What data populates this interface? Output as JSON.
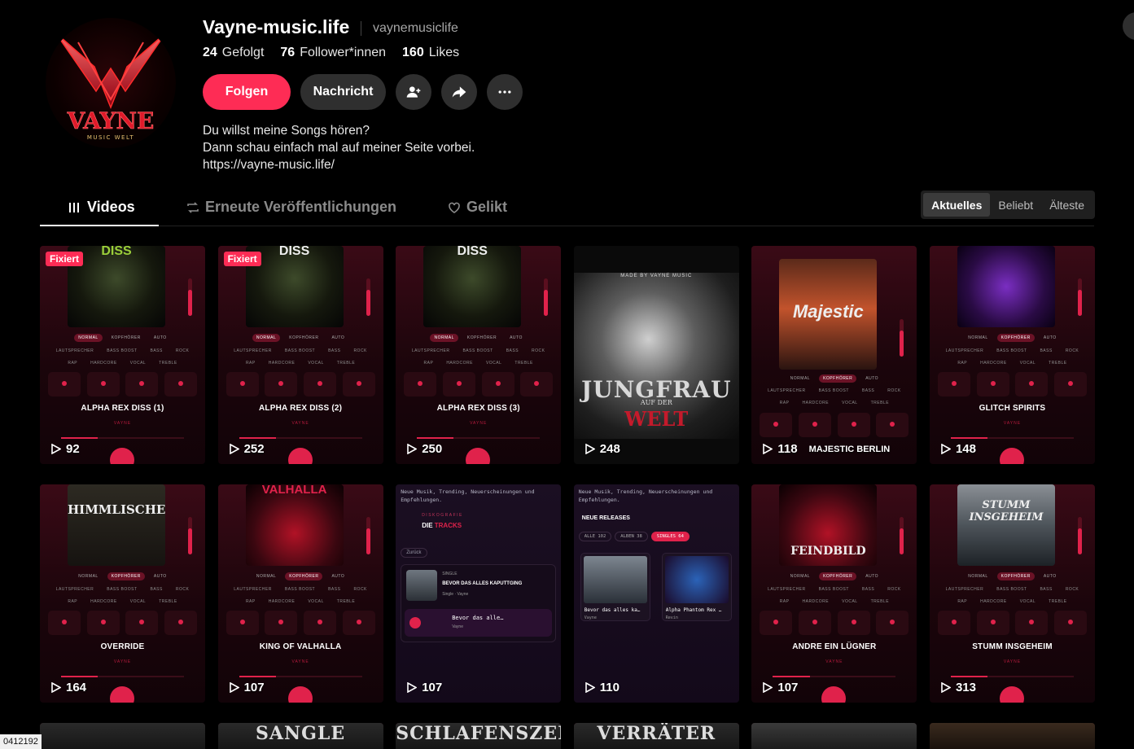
{
  "profile": {
    "name": "Vayne-music.life",
    "username": "vaynemusiclife",
    "avatar_text": "VAYNE",
    "avatar_subtext": "MUSIC WELT",
    "stats": [
      {
        "value": "24",
        "label": "Gefolgt"
      },
      {
        "value": "76",
        "label": "Follower*innen"
      },
      {
        "value": "160",
        "label": "Likes"
      }
    ],
    "follow_label": "Folgen",
    "message_label": "Nachricht",
    "bio": [
      "Du willst meine Songs hören?",
      "Dann schau einfach mal auf meiner Seite vorbei.",
      "https://vayne-music.life/"
    ]
  },
  "tabs": [
    {
      "label": "Videos",
      "icon": "grid-icon"
    },
    {
      "label": "Erneute Veröffentlichungen",
      "icon": "repost-icon"
    },
    {
      "label": "Gelikt",
      "icon": "heart-icon"
    }
  ],
  "sort": [
    "Aktuelles",
    "Beliebt",
    "Älteste"
  ],
  "pinned_label": "Fixiert",
  "player_ui": {
    "modes": [
      "NORMAL",
      "KOPFHÖRER",
      "AUTO"
    ],
    "row2": [
      "LAUTSPRECHER",
      "BASS BOOST",
      "BASS",
      "ROCK"
    ],
    "row3": [
      "RAP",
      "HARDCORE",
      "VOCAL",
      "TREBLE"
    ],
    "artist": "VAYNE"
  },
  "videos": [
    {
      "views": "92",
      "title": "ALPHA REX DISS (1)",
      "pinned": true,
      "cover_text": "DISS"
    },
    {
      "views": "252",
      "title": "ALPHA REX DISS (2)",
      "pinned": true,
      "cover_text": "DISS"
    },
    {
      "views": "250",
      "title": "ALPHA REX DISS (3)",
      "pinned": false,
      "cover_text": "DISS"
    },
    {
      "views": "248",
      "poster_small": "MADE BY VAYNE MUSIC",
      "poster_title": "JUNGFRAU",
      "poster_sub": "WELT",
      "poster_mid": "AUF DER"
    },
    {
      "views": "118",
      "title": "MAJESTIC BERLIN",
      "cover_text": "Majestic"
    },
    {
      "views": "148",
      "title": "GLITCH SPIRITS"
    },
    {
      "views": "164",
      "title": "OVERRIDE",
      "cover_text": "HIMMLISCHE"
    },
    {
      "views": "107",
      "title": "KING OF VALHALLA",
      "cover_text": "VALHALLA"
    },
    {
      "views": "107",
      "web_head": "Neue Musik, Trending, Neuerscheinungen und Empfehlungen.",
      "kicker": "DISKOGRAFIE",
      "heading_a": "DIE",
      "heading_b": "TRACKS",
      "back": "Zurück",
      "single": "SINGLE",
      "track": "BEVOR DAS ALLES KAPUTTGING",
      "track_artist": "Single · Vayne",
      "player_title": "Bevor das alle…",
      "player_artist": "Vayne"
    },
    {
      "views": "110",
      "web_head": "Neue Musik, Trending, Neuerscheinungen und Empfehlungen.",
      "heading": "NEUE RELEASES",
      "chips": [
        "ALLE 102",
        "ALBEN 38",
        "SINGLES 64"
      ],
      "rel1_t": "Bevor das alles ka…",
      "rel1_a": "Vayne",
      "rel2_t": "Alpha Phantom Rex …",
      "rel2_a": "Revin"
    },
    {
      "views": "107",
      "title": "ANDRE EIN LÜGNER",
      "cover_text": "FEINDBILD"
    },
    {
      "views": "313",
      "title": "STUMM INSGEHEIM",
      "cover_text": "STUMM INSGEHEIM"
    }
  ],
  "row3": [
    "",
    "SANGLE",
    "SCHLAFENSZEIT",
    "VERRÄTER",
    "",
    ""
  ],
  "corner_id": "0412192"
}
